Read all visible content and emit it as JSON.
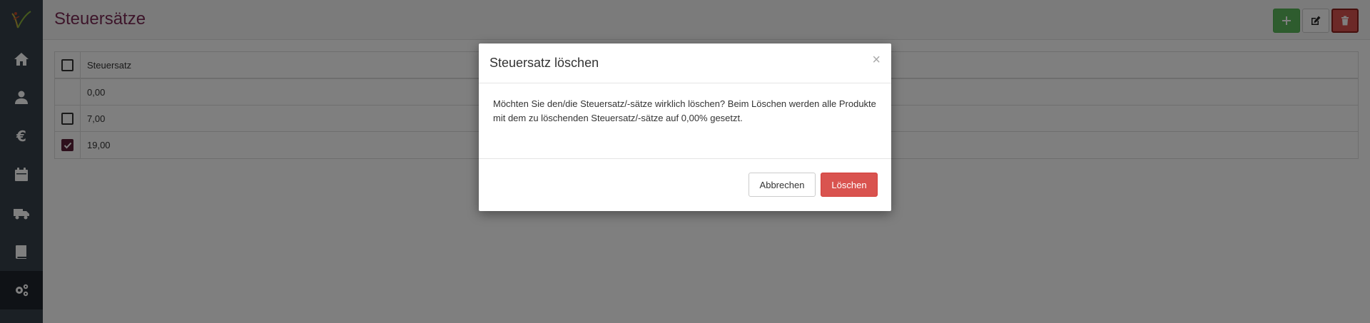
{
  "page": {
    "title": "Steuersätze"
  },
  "sidebar": {
    "items": [
      {
        "icon": "home-icon"
      },
      {
        "icon": "user-icon"
      },
      {
        "icon": "euro-icon"
      },
      {
        "icon": "calendar-icon"
      },
      {
        "icon": "truck-icon"
      },
      {
        "icon": "book-icon"
      },
      {
        "icon": "gears-icon",
        "active": true
      }
    ]
  },
  "header_actions": {
    "add": "plus-icon",
    "edit": "edit-icon",
    "delete": "trash-icon"
  },
  "table": {
    "column_header": "Steuersatz",
    "rows": [
      {
        "value": "0,00",
        "has_checkbox": false,
        "checked": false
      },
      {
        "value": "7,00",
        "has_checkbox": true,
        "checked": false
      },
      {
        "value": "19,00",
        "has_checkbox": true,
        "checked": true
      }
    ]
  },
  "modal": {
    "title": "Steuersatz löschen",
    "close": "×",
    "body": "Möchten Sie den/die Steuersatz/-sätze wirklich löschen? Beim Löschen werden alle Produkte mit dem zu löschenden Steuersatz/-sätze auf 0,00% gesetzt.",
    "cancel_label": "Abbrechen",
    "delete_label": "Löschen"
  },
  "colors": {
    "title": "#7a2a55",
    "sidebar": "#37404a",
    "add_button": "#5cb85c",
    "delete_button": "#d9534f",
    "checked": "#5a2138"
  }
}
